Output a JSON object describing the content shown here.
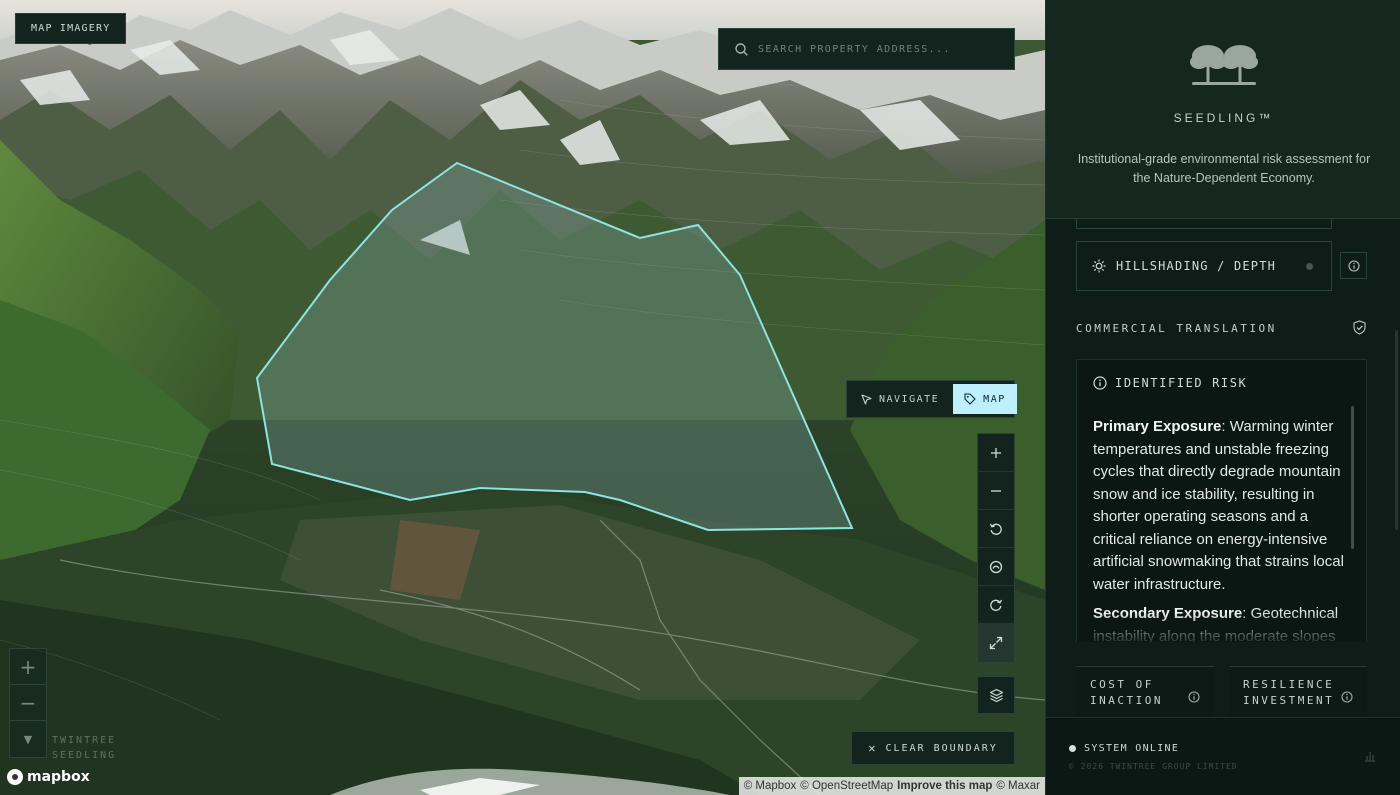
{
  "map": {
    "tag_label": "MAP IMAGERY",
    "search": {
      "placeholder": "SEARCH PROPERTY ADDRESS..."
    },
    "mode_toggle": {
      "navigate_label": "NAVIGATE",
      "map_label": "MAP",
      "active": "MAP"
    },
    "controls": [
      "zoom-in",
      "zoom-out",
      "rotate-left",
      "reset-north",
      "rotate-right",
      "fullscreen"
    ],
    "layers_icon": "layers-icon",
    "clear_boundary_label": "CLEAR BOUNDARY",
    "ghost_brand": [
      "TWINTREE",
      "SEEDLING"
    ],
    "logo_text": "mapbox",
    "attribution": {
      "mapbox": "© Mapbox",
      "osm": "© OpenStreetMap",
      "improve": "Improve this map",
      "maxar": "© Maxar"
    },
    "boundary_color": "#8fe3e0"
  },
  "panel": {
    "brand_name": "SEEDLING™",
    "tagline": "Institutional-grade environmental risk assessment for the Nature-Dependent Economy.",
    "layer": {
      "label": "HILLSHADING / DEPTH",
      "icon": "sun-icon"
    },
    "section_title": "COMMERCIAL TRANSLATION",
    "risk": {
      "heading": "IDENTIFIED RISK",
      "primary_label": "Primary Exposure",
      "primary_text": ": Warming winter temperatures and unstable freezing cycles that directly degrade mountain snow and ice stability, resulting in shorter operating seasons and a critical reliance on energy-intensive artificial snowmaking that strains local water infrastructure.",
      "secondary_label": "Secondary Exposure",
      "secondary_text": ": Geotechnical instability along the moderate slopes"
    },
    "metrics": [
      {
        "label": "COST OF INACTION"
      },
      {
        "label": "RESILIENCE INVESTMENT"
      }
    ],
    "footer": {
      "status": "SYSTEM ONLINE",
      "copyright": "© 2026 TWINTREE GROUP LIMITED"
    }
  }
}
